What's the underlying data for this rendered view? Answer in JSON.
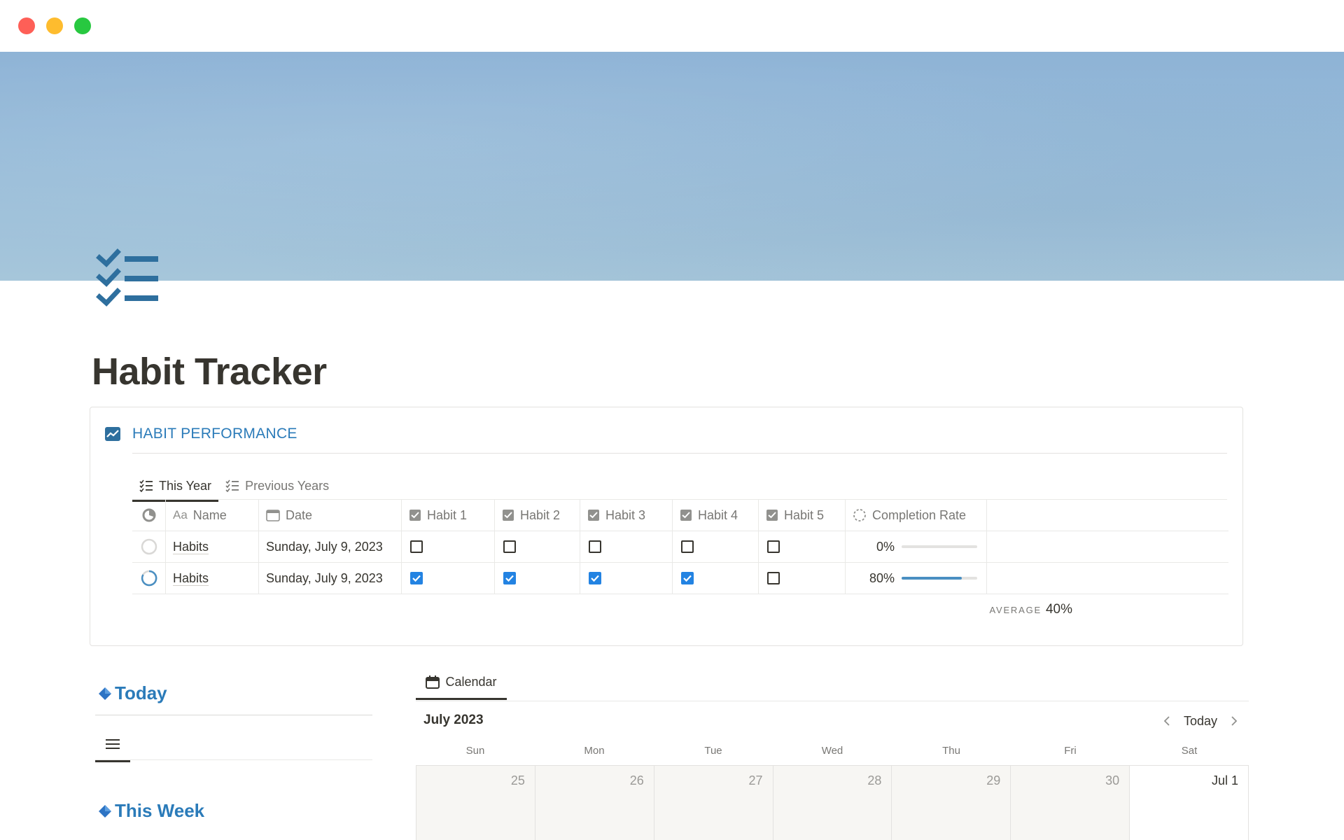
{
  "page": {
    "title": "Habit Tracker"
  },
  "performance": {
    "title": "HABIT PERFORMANCE",
    "tabs": [
      {
        "label": "This Year"
      },
      {
        "label": "Previous Years"
      }
    ],
    "columns": {
      "name": "Name",
      "date": "Date",
      "habits": [
        "Habit 1",
        "Habit 2",
        "Habit 3",
        "Habit 4",
        "Habit 5"
      ],
      "completion": "Completion Rate"
    },
    "rows": [
      {
        "name": "Habits",
        "date": "Sunday, July 9, 2023",
        "checks": [
          false,
          false,
          false,
          false,
          false
        ],
        "rate_text": "0%",
        "rate": 0
      },
      {
        "name": "Habits",
        "date": "Sunday, July 9, 2023",
        "checks": [
          true,
          true,
          true,
          true,
          false
        ],
        "rate_text": "80%",
        "rate": 0.8
      }
    ],
    "average_label": "AVERAGE",
    "average_value": "40%"
  },
  "left": {
    "today_title": "Today",
    "week_title": "This Week"
  },
  "calendar": {
    "tab_label": "Calendar",
    "month": "July 2023",
    "today_button": "Today",
    "weekdays": [
      "Sun",
      "Mon",
      "Tue",
      "Wed",
      "Thu",
      "Fri",
      "Sat"
    ],
    "first_week": [
      "25",
      "26",
      "27",
      "28",
      "29",
      "30",
      "Jul 1"
    ]
  },
  "colors": {
    "accent": "#2b7bb9",
    "checkbox": "#2383e2",
    "progress": "#4a8fc2"
  }
}
